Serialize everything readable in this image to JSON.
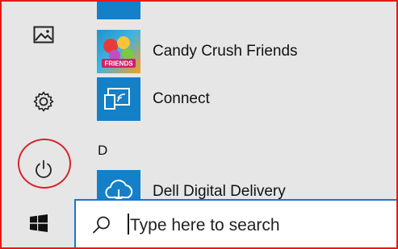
{
  "rail": {
    "icons": [
      "photos-icon",
      "settings-gear-icon",
      "power-icon"
    ]
  },
  "apps": [
    {
      "label": "Candy Crush Friends",
      "icon": "candy-crush-friends-tile",
      "tile_text": "FRIENDS"
    },
    {
      "label": "Connect",
      "icon": "connect-tile"
    },
    {
      "label": "Dell Digital Delivery",
      "icon": "dell-cloud-tile"
    }
  ],
  "section": {
    "letter": "D"
  },
  "search": {
    "placeholder": "Type here to search"
  },
  "annotation": {
    "color": "#d8232a"
  },
  "colors": {
    "accent": "#1380c8",
    "frame": "#e81818",
    "search_border": "#1c74d0"
  }
}
